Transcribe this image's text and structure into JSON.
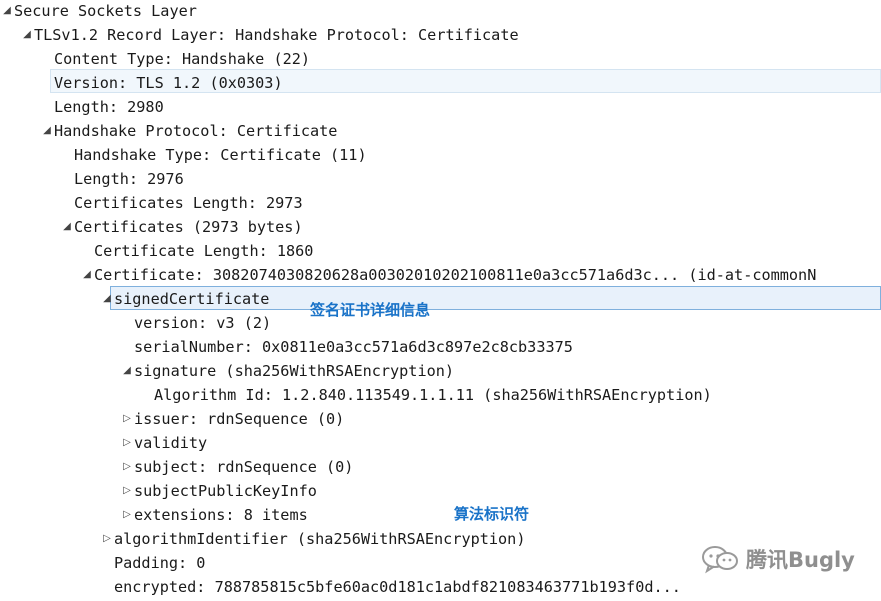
{
  "tree": {
    "ssl": "Secure Sockets Layer",
    "record": "TLSv1.2 Record Layer: Handshake Protocol: Certificate",
    "content_type": "Content Type: Handshake (22)",
    "version": "Version: TLS 1.2 (0x0303)",
    "length": "Length: 2980",
    "handshake": "Handshake Protocol: Certificate",
    "handshake_type": "Handshake Type: Certificate (11)",
    "hs_length": "Length: 2976",
    "certs_length": "Certificates Length: 2973",
    "certs": "Certificates (2973 bytes)",
    "cert_length": "Certificate Length: 1860",
    "certificate": "Certificate: 3082074030820628a00302010202100811e0a3cc571a6d3c... (id-at-commonN",
    "signed_certificate": "signedCertificate",
    "version_v3": "version: v3 (2)",
    "serial": "serialNumber: 0x0811e0a3cc571a6d3c897e2c8cb33375",
    "signature": "signature (sha256WithRSAEncryption)",
    "algorithm_id": "Algorithm Id: 1.2.840.113549.1.1.11 (sha256WithRSAEncryption)",
    "issuer": "issuer: rdnSequence (0)",
    "validity": "validity",
    "subject": "subject: rdnSequence (0)",
    "spki": "subjectPublicKeyInfo",
    "extensions": "extensions: 8 items",
    "algorithm_identifier": "algorithmIdentifier (sha256WithRSAEncryption)",
    "padding": "Padding: 0",
    "encrypted": "encrypted: 788785815c5bfe60ac0d181c1abdf821083463771b193f0d..."
  },
  "icons": {
    "expanded": "◢",
    "collapsed": "▷"
  },
  "annotations": {
    "signed_cert_detail": "签名证书详细信息",
    "algorithm_identifier_note": "算法标识符"
  },
  "watermark": {
    "text": "腾讯Bugly"
  },
  "colors": {
    "annotation": "#1a73c8",
    "selection": "#e8f1fb",
    "selection_border": "#7fb0dd"
  }
}
